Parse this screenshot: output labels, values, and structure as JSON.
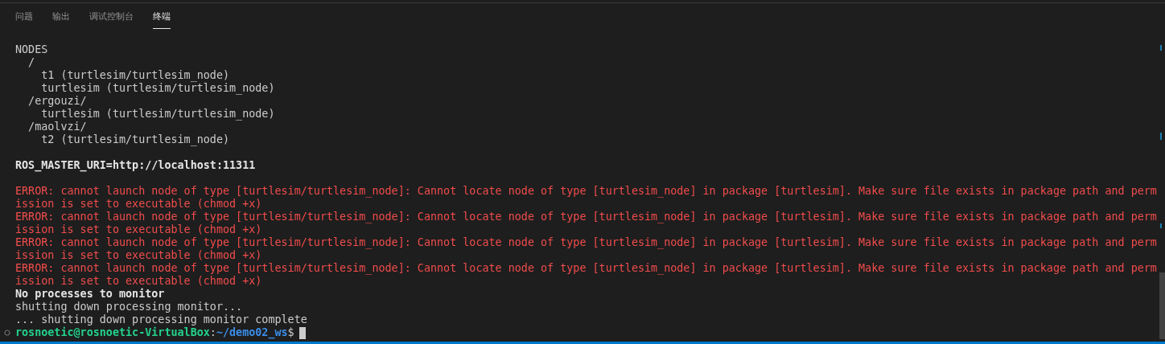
{
  "tabs": [
    {
      "label": "问题",
      "selected": false
    },
    {
      "label": "输出",
      "selected": false
    },
    {
      "label": "调试控制台",
      "selected": false
    },
    {
      "label": "终端",
      "selected": true
    }
  ],
  "terminal": {
    "lines": [
      {
        "kind": "plain",
        "text": "NODES"
      },
      {
        "kind": "plain",
        "text": "  /"
      },
      {
        "kind": "plain",
        "text": "    t1 (turtlesim/turtlesim_node)"
      },
      {
        "kind": "plain",
        "text": "    turtlesim (turtlesim/turtlesim_node)"
      },
      {
        "kind": "plain",
        "text": "  /ergouzi/"
      },
      {
        "kind": "plain",
        "text": "    turtlesim (turtlesim/turtlesim_node)"
      },
      {
        "kind": "plain",
        "text": "  /maolvzi/"
      },
      {
        "kind": "plain",
        "text": "    t2 (turtlesim/turtlesim_node)"
      },
      {
        "kind": "blank"
      },
      {
        "kind": "bold",
        "text": "ROS_MASTER_URI=http://localhost:11311"
      },
      {
        "kind": "blank"
      },
      {
        "kind": "error",
        "text": "ERROR: cannot launch node of type [turtlesim/turtlesim_node]: Cannot locate node of type [turtlesim_node] in package [turtlesim]. Make sure file exists in package path and perm"
      },
      {
        "kind": "error",
        "text": "ission is set to executable (chmod +x)"
      },
      {
        "kind": "error",
        "text": "ERROR: cannot launch node of type [turtlesim/turtlesim_node]: Cannot locate node of type [turtlesim_node] in package [turtlesim]. Make sure file exists in package path and perm"
      },
      {
        "kind": "error",
        "text": "ission is set to executable (chmod +x)"
      },
      {
        "kind": "error",
        "text": "ERROR: cannot launch node of type [turtlesim/turtlesim_node]: Cannot locate node of type [turtlesim_node] in package [turtlesim]. Make sure file exists in package path and perm"
      },
      {
        "kind": "error",
        "text": "ission is set to executable (chmod +x)"
      },
      {
        "kind": "error",
        "text": "ERROR: cannot launch node of type [turtlesim/turtlesim_node]: Cannot locate node of type [turtlesim_node] in package [turtlesim]. Make sure file exists in package path and perm"
      },
      {
        "kind": "error",
        "text": "ission is set to executable (chmod +x)"
      },
      {
        "kind": "bold",
        "text": "No processes to monitor"
      },
      {
        "kind": "plain",
        "text": "shutting down processing monitor..."
      },
      {
        "kind": "plain",
        "text": "... shutting down processing monitor complete"
      }
    ],
    "prompt": {
      "user_host": "rosnoetic@rosnoetic-VirtualBox",
      "separator": ":",
      "path": "~/demo02_ws",
      "symbol": "$"
    }
  }
}
